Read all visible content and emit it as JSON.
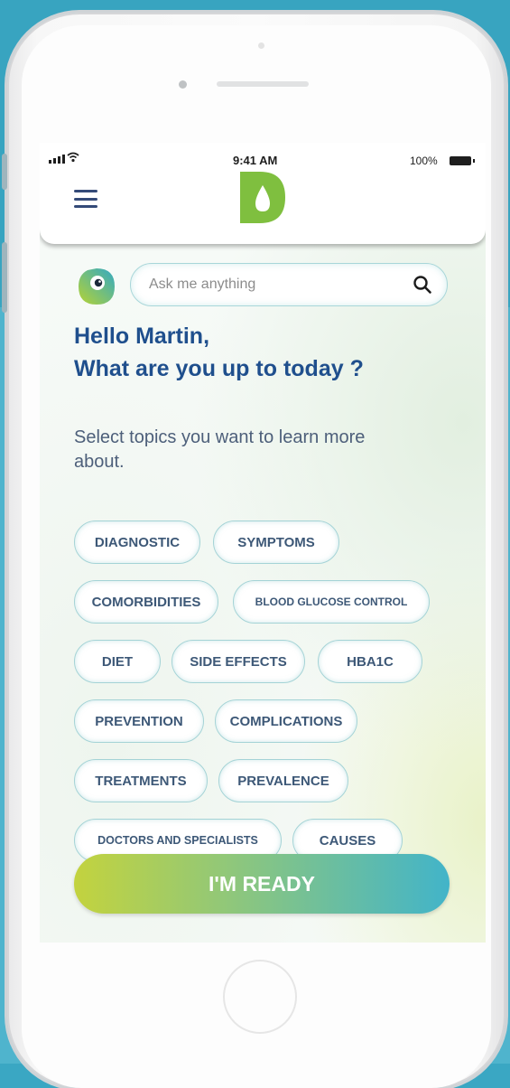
{
  "status_bar": {
    "time": "9:41 AM",
    "battery": "100%"
  },
  "search": {
    "placeholder": "Ask me anything"
  },
  "greeting": {
    "line1": "Hello Martin,",
    "line2": "What are you up to today ?"
  },
  "subtitle": "Select topics you want to learn more about.",
  "topics": [
    "DIAGNOSTIC",
    "SYMPTOMS",
    "COMORBIDITIES",
    "BLOOD GLUCOSE CONTROL",
    "DIET",
    "SIDE EFFECTS",
    "HBA1C",
    "PREVENTION",
    "COMPLICATIONS",
    "TREATMENTS",
    "PREVALENCE",
    "DOCTORS AND SPECIALISTS",
    "CAUSES"
  ],
  "cta": {
    "label": "I'M READY"
  },
  "colors": {
    "background": "#3aa7c3",
    "heading": "#1f4f8d",
    "chip_border": "#a4d3d6",
    "logo_green": "#7fbf3f",
    "cta_start": "#c3d33e",
    "cta_end": "#42b4c9"
  },
  "icons": [
    "menu-icon",
    "logo-drop-icon",
    "chat-bot-avatar-icon",
    "search-icon",
    "signal-icon",
    "wifi-icon",
    "battery-icon"
  ]
}
